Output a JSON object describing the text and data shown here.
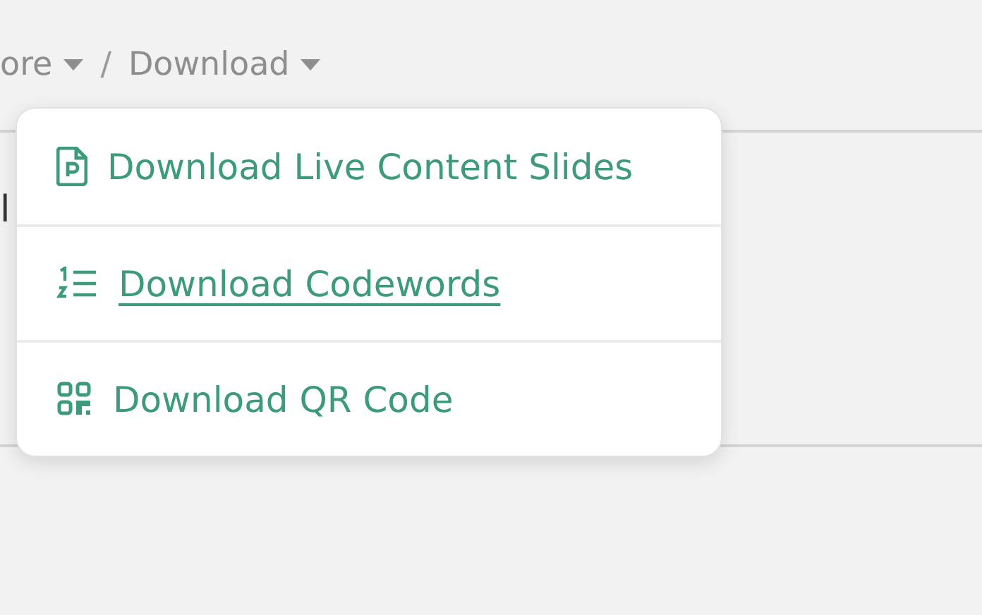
{
  "breadcrumb_separator": "/",
  "breadcrumb": [
    {
      "label": "ore",
      "dropdown": true
    },
    {
      "label": "Download",
      "dropdown": true
    }
  ],
  "background_text": "l",
  "menu": [
    {
      "label": "Download Live Content Slides",
      "kind": "slides",
      "hovered": false
    },
    {
      "label": "Download Codewords",
      "kind": "list",
      "hovered": true
    },
    {
      "label": "Download QR Code",
      "kind": "qr",
      "hovered": false
    }
  ]
}
